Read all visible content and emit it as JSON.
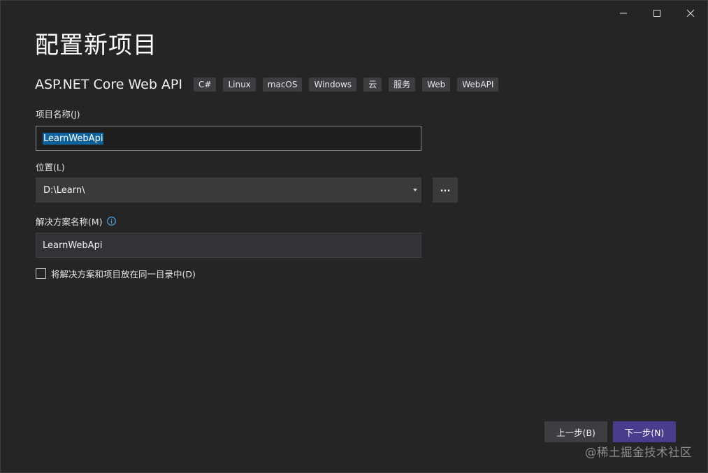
{
  "window": {
    "controls": {
      "minimize": "minimize-icon",
      "maximize": "maximize-icon",
      "close": "close-icon"
    }
  },
  "page": {
    "title": "配置新项目"
  },
  "template": {
    "name": "ASP.NET Core Web API",
    "tags": [
      "C#",
      "Linux",
      "macOS",
      "Windows",
      "云",
      "服务",
      "Web",
      "WebAPI"
    ]
  },
  "fields": {
    "project_name": {
      "label": "项目名称(J)",
      "value": "LearnWebApi"
    },
    "location": {
      "label": "位置(L)",
      "value": "D:\\Learn\\",
      "browse_label": "..."
    },
    "solution_name": {
      "label": "解决方案名称(M)",
      "value": "LearnWebApi",
      "info_icon": "info-icon"
    }
  },
  "options": {
    "same_directory": {
      "label": "将解决方案和项目放在同一目录中(D)",
      "checked": false
    }
  },
  "footer": {
    "back_label": "上一步(B)",
    "next_label": "下一步(N)"
  },
  "watermark": "@稀土掘金技术社区",
  "colors": {
    "background": "#252526",
    "primary_button": "#4a3c8c",
    "selection": "#0e639c",
    "info": "#4fa3e0"
  }
}
